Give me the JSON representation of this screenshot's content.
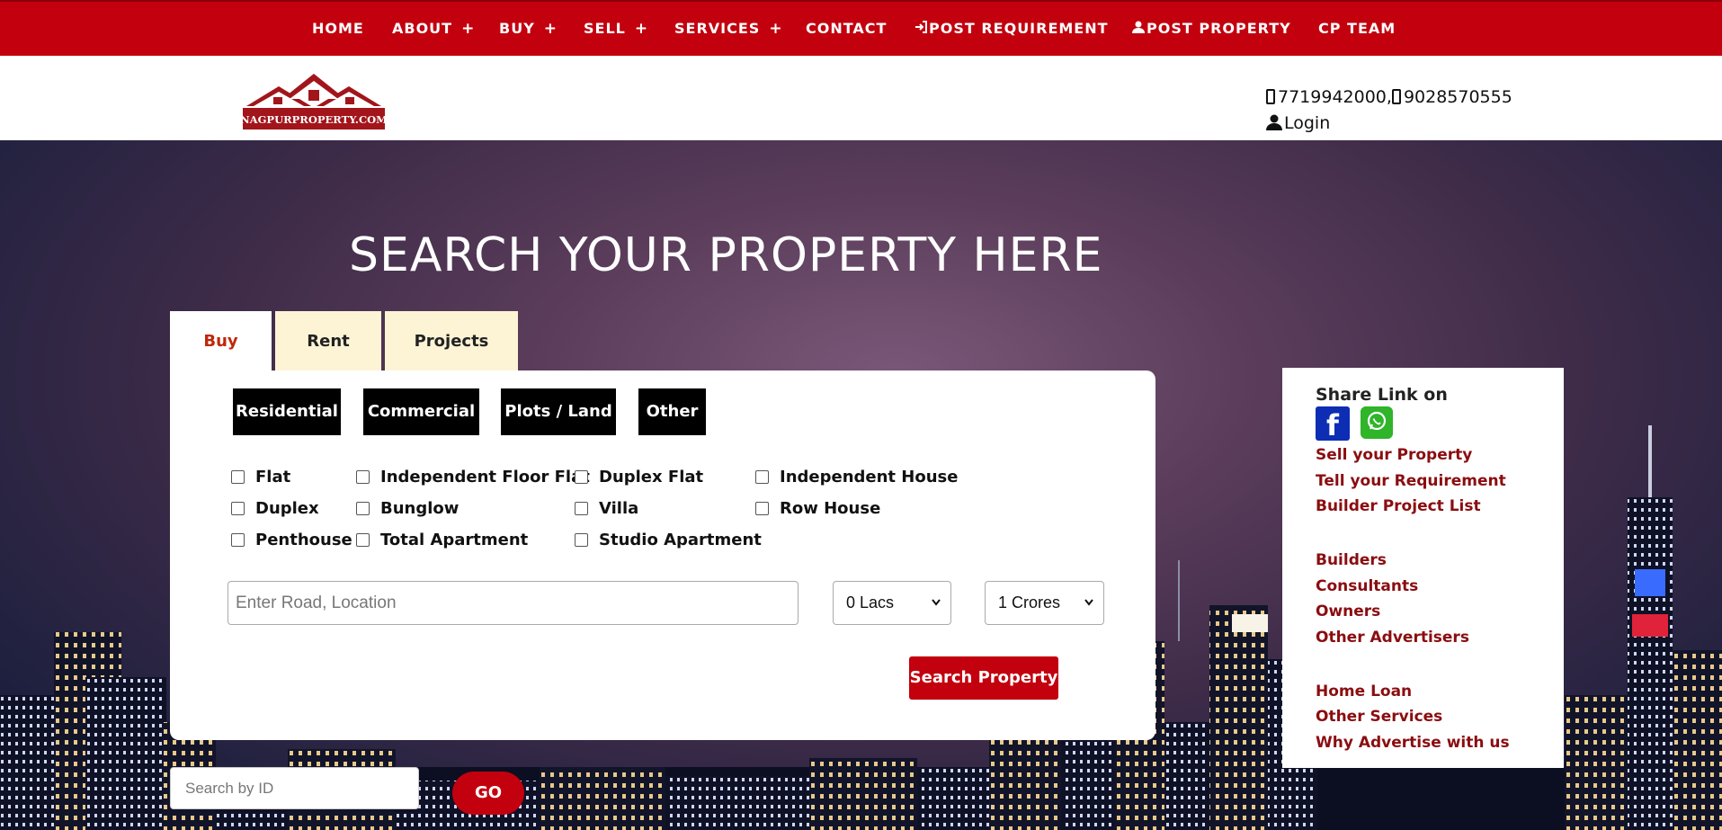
{
  "nav": {
    "home": "HOME",
    "about": "ABOUT",
    "buy": "BUY",
    "sell": "SELL",
    "services": "SERVICES",
    "contact": "CONTACT",
    "post_requirement": "POST REQUIREMENT",
    "post_property": "POST PROPERTY",
    "cp_team": "CP TEAM",
    "plus": "+"
  },
  "header": {
    "logo_text": "NAGPURPROPERTY.COM",
    "phones": "7719942000,",
    "phone2": "9028570555",
    "login": "Login"
  },
  "hero": {
    "title": "SEARCH YOUR PROPERTY HERE"
  },
  "tabs": [
    "Buy",
    "Rent",
    "Projects"
  ],
  "categories": [
    "Residential",
    "Commercial",
    "Plots / Land",
    "Other"
  ],
  "property_types": {
    "col1": [
      "Flat",
      "Duplex",
      "Penthouse"
    ],
    "col2": [
      "Independent Floor Flat",
      "Bunglow",
      "Total Apartment"
    ],
    "col3": [
      "Duplex Flat",
      "Villa",
      "Studio Apartment"
    ],
    "col4": [
      "Independent House",
      "Row House"
    ]
  },
  "search": {
    "location_placeholder": "Enter Road, Location",
    "min_price": "0 Lacs",
    "max_price": "1 Crores",
    "button": "Search Property",
    "id_placeholder": "Search by ID",
    "go": "GO"
  },
  "sidebox": {
    "share_title": "Share Link on",
    "fb_letter": "f",
    "links_a": [
      "Sell your Property",
      "Tell your Requirement",
      "Builder Project List"
    ],
    "links_b": [
      "Builders",
      "Consultants",
      "Owners",
      "Other Advertisers"
    ],
    "links_c": [
      "Home Loan",
      "Other Services",
      "Why Advertise with us"
    ]
  },
  "colors": {
    "brand_red": "#c3000e",
    "link_dark_red": "#8a0d10",
    "tab_cream": "#fdf4d6"
  }
}
